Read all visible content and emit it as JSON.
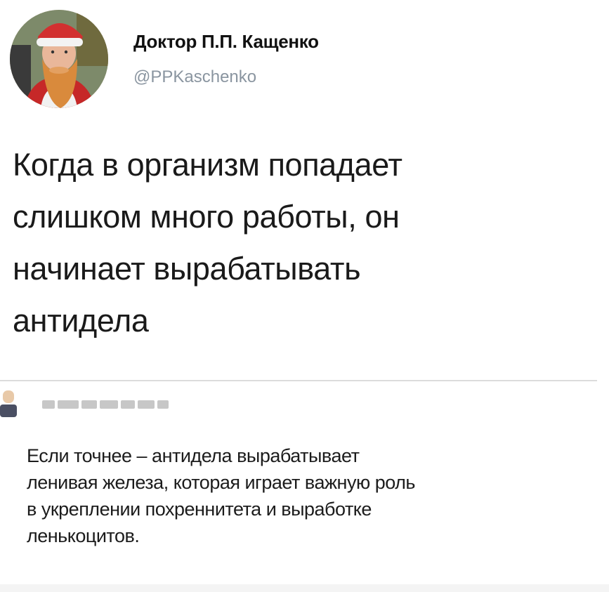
{
  "tweet": {
    "author_name": "Доктор П.П. Кащенко",
    "author_handle": "@PPKaschenko",
    "text": "Когда в организм попадает\nслишком много работы, он\nначинает вырабатывать\nантидела",
    "avatar_icon": "santa-beard-avatar"
  },
  "reply": {
    "author_name": "",
    "text": "Если точнее – антидела вырабатывает\nленивая железа, которая играет важную роль\nв укреплении похреннитета и выработке\nленькоцитов.",
    "avatar_icon": "blurred-user-avatar"
  },
  "colors": {
    "handle": "#8a95a0",
    "divider": "#dcdcdc",
    "text": "#1a1a1a"
  }
}
